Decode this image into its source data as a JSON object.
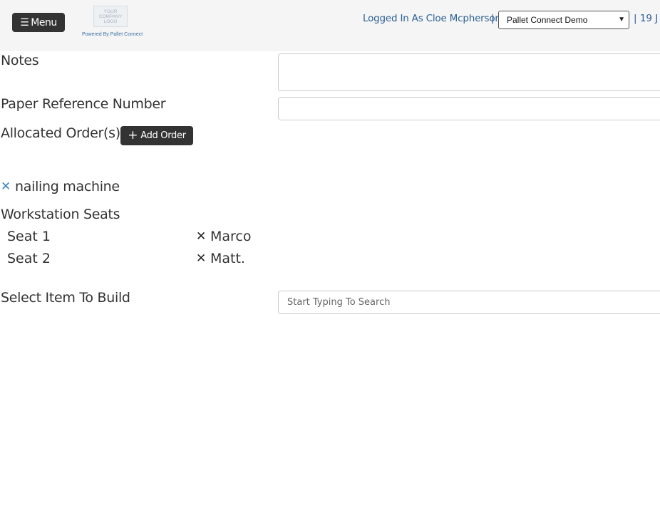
{
  "header": {
    "menu_label": "Menu",
    "logo_lines": [
      "YOUR",
      "COMPANY",
      "LOGO"
    ],
    "powered_by": "Powered By Pallet Connect",
    "logged_in_text": "Logged In As Cloe Mcpherson",
    "separator": "|",
    "selected_site": "Pallet Connect Demo",
    "date_partial": "| 19 J"
  },
  "form": {
    "notes_label": "Notes",
    "notes_value": "",
    "paper_ref_label": "Paper Reference Number",
    "paper_ref_value": "",
    "allocated_orders_label": "Allocated Order(s)",
    "add_order_label": "Add Order",
    "machine_name": "nailing machine",
    "workstation_seats_label": "Workstation Seats",
    "seats": [
      {
        "seat": "Seat 1",
        "operator": "Marco"
      },
      {
        "seat": "Seat 2",
        "operator": "Matt."
      }
    ],
    "select_item_label": "Select Item To Build",
    "search_placeholder": "Start Typing To Search"
  },
  "icons": {
    "menu": "hamburger-icon",
    "plus": "plus-icon",
    "remove": "close-icon",
    "dropdown": "chevron-down-icon"
  },
  "colors": {
    "header_bg": "#f5f5f5",
    "dark_button": "#333333",
    "link_blue": "#2a5f95",
    "remove_blue": "#3a84c9"
  }
}
